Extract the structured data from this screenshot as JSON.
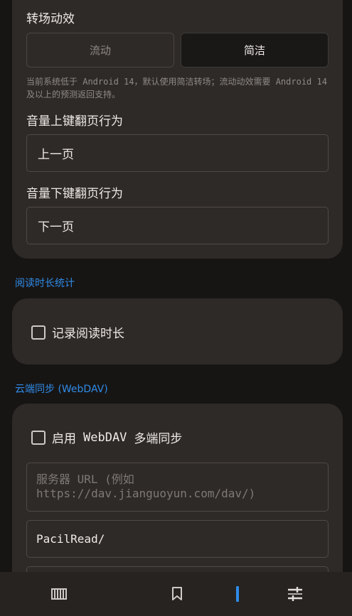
{
  "transition": {
    "label": "转场动效",
    "options": [
      "流动",
      "简洁"
    ],
    "selected": "简洁",
    "hint": "当前系统低于 Android 14，默认使用简洁转场；流动动效需要 Android 14 及以上的预测返回支持。"
  },
  "volume_up": {
    "label": "音量上键翻页行为",
    "value": "上一页"
  },
  "volume_down": {
    "label": "音量下键翻页行为",
    "value": "下一页"
  },
  "reading_time": {
    "section_title": "阅读时长统计",
    "checkbox_label": "记录阅读时长",
    "checked": false
  },
  "webdav": {
    "section_title": "云端同步 (WebDAV)",
    "enable_prefix": "启用",
    "enable_mono": "WebDAV",
    "enable_suffix": "多端同步",
    "enabled": false,
    "url_placeholder": "服务器 URL (例如 https://dav.jianguoyun.com/dav/)",
    "path_value": "PacilRead/"
  },
  "bottom_nav": {
    "items": [
      "library-icon",
      "bookmark-icon",
      "reader-icon",
      "settings-icon"
    ],
    "active_index": 2,
    "accent": "#2f8be8"
  }
}
